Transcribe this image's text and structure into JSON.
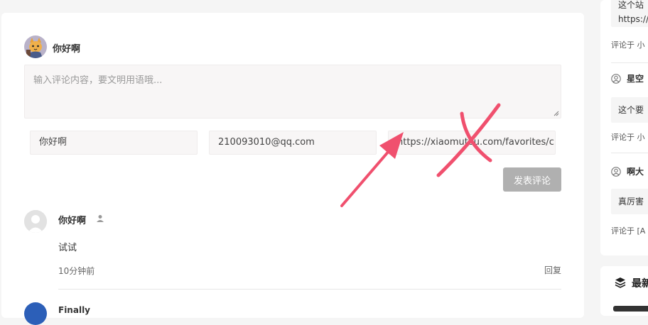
{
  "form": {
    "current_user_name": "你好啊",
    "comment_placeholder": "输入评论内容，要文明用语哦...",
    "name_value": "你好啊",
    "email_value": "210093010@qq.com",
    "url_value": "https://xiaomutou.com/favorites/c",
    "submit_label": "发表评论"
  },
  "comments": [
    {
      "author": "你好啊",
      "text": "试试",
      "time": "10分钟前",
      "reply_label": "回复"
    },
    {
      "author": "Finally"
    }
  ],
  "sidebar": {
    "recent_comments": [
      {
        "text_line1": "这个站",
        "text_line2": "https://",
        "meta": "评论于 小"
      },
      {
        "author": "星空",
        "text": "这个要",
        "meta": "评论于 小"
      },
      {
        "author": "啊大",
        "text": "真厉害",
        "meta": "评论于 [A"
      }
    ],
    "next_widget_title": "最新"
  },
  "annotation": {
    "arrow_color": "#f0506e",
    "cross_color": "#f0506e"
  }
}
